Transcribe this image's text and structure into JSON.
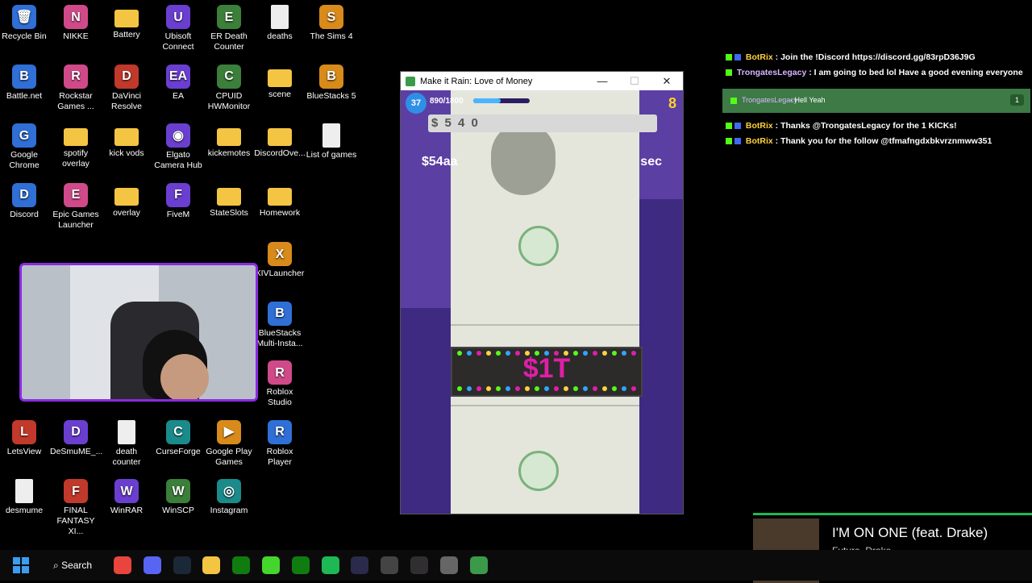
{
  "desktop": {
    "icons": [
      {
        "label": "Recycle Bin",
        "glyph": "🗑"
      },
      {
        "label": "NIKKE",
        "glyph": "N"
      },
      {
        "label": "Battery",
        "glyph": ""
      },
      {
        "label": "Ubisoft Connect",
        "glyph": "U"
      },
      {
        "label": "ER Death Counter",
        "glyph": "E"
      },
      {
        "label": "deaths",
        "glyph": ""
      },
      {
        "label": "The Sims 4",
        "glyph": "S"
      },
      {
        "label": "Battle.net",
        "glyph": "B"
      },
      {
        "label": "Rockstar Games ...",
        "glyph": "R"
      },
      {
        "label": "DaVinci Resolve",
        "glyph": "D"
      },
      {
        "label": "EA",
        "glyph": "EA"
      },
      {
        "label": "CPUID HWMonitor",
        "glyph": "C"
      },
      {
        "label": "scene",
        "glyph": ""
      },
      {
        "label": "BlueStacks 5",
        "glyph": "B"
      },
      {
        "label": "Google Chrome",
        "glyph": "G"
      },
      {
        "label": "spotify overlay",
        "glyph": ""
      },
      {
        "label": "kick vods",
        "glyph": ""
      },
      {
        "label": "Elgato Camera Hub",
        "glyph": "◉"
      },
      {
        "label": "kickemotes",
        "glyph": ""
      },
      {
        "label": "DiscordOve...",
        "glyph": ""
      },
      {
        "label": "List of games",
        "glyph": ""
      },
      {
        "label": "Discord",
        "glyph": "D"
      },
      {
        "label": "Epic Games Launcher",
        "glyph": "E"
      },
      {
        "label": "overlay",
        "glyph": ""
      },
      {
        "label": "FiveM",
        "glyph": "F"
      },
      {
        "label": "StateSlots",
        "glyph": ""
      },
      {
        "label": "Homework",
        "glyph": ""
      },
      {
        "label": "XIVLauncher",
        "glyph": "X"
      },
      {
        "label": "BlueStacks Multi-Insta...",
        "glyph": "B"
      },
      {
        "label": "Roblox Studio",
        "glyph": "R"
      },
      {
        "label": "LetsView",
        "glyph": "L"
      },
      {
        "label": "DeSmuME_...",
        "glyph": "D"
      },
      {
        "label": "death counter",
        "glyph": ""
      },
      {
        "label": "CurseForge",
        "glyph": "C"
      },
      {
        "label": "Google Play Games",
        "glyph": "▶"
      },
      {
        "label": "Roblox Player",
        "glyph": "R"
      },
      {
        "label": "desmume",
        "glyph": ""
      },
      {
        "label": "FINAL FANTASY XI...",
        "glyph": "F"
      },
      {
        "label": "WinRAR",
        "glyph": "W"
      },
      {
        "label": "WinSCP",
        "glyph": "W"
      },
      {
        "label": "Instagram",
        "glyph": "◎"
      }
    ]
  },
  "game": {
    "window_title": "Make it Rain: Love of Money",
    "level": "37",
    "xp_text": "890/1800",
    "xp_progress": 0.49,
    "money_display": "$ 5 4 0",
    "coins": "8",
    "rate_left": "$54aa",
    "rate_right": "sec",
    "marquee": "$1T",
    "controls": {
      "minimize": "—",
      "maximize": "☐",
      "close": "✕"
    }
  },
  "chat": {
    "messages": [
      {
        "user": "BotRix",
        "text": " : Join the !Discord https://discord.gg/83rpD36J9G",
        "color": "#ffd23f"
      },
      {
        "user": "TrongatesLegacy",
        "text": " : I am going to bed lol Have a good evening everyone",
        "color": "#d8b6ff"
      },
      {
        "user": "BotRix",
        "text": " : Thanks @TrongatesLegacy for the 1 KICKs!",
        "color": "#ffd23f"
      },
      {
        "user": "BotRix",
        "text": " : Thank you for the follow @tfmafngdxbkvrznmww351",
        "color": "#ffd23f"
      }
    ],
    "highlight": {
      "user": "TrongatesLegacy",
      "text": "- Hell Yeah",
      "count": "1"
    }
  },
  "now_playing": {
    "title": "I'M ON ONE (feat. Drake)",
    "artist": "Future, Drake",
    "progress": 0.97
  },
  "taskbar": {
    "search_label": "Search",
    "apps": [
      "chrome",
      "discord",
      "steam",
      "files",
      "xbox-app",
      "razer",
      "xbox",
      "spotify",
      "elgato",
      "calculator",
      "obs",
      "settings",
      "make-it-rain"
    ]
  },
  "colors": {
    "accent": "#8a2be2",
    "kick_green": "#53fc18",
    "spotify_green": "#1db954"
  }
}
